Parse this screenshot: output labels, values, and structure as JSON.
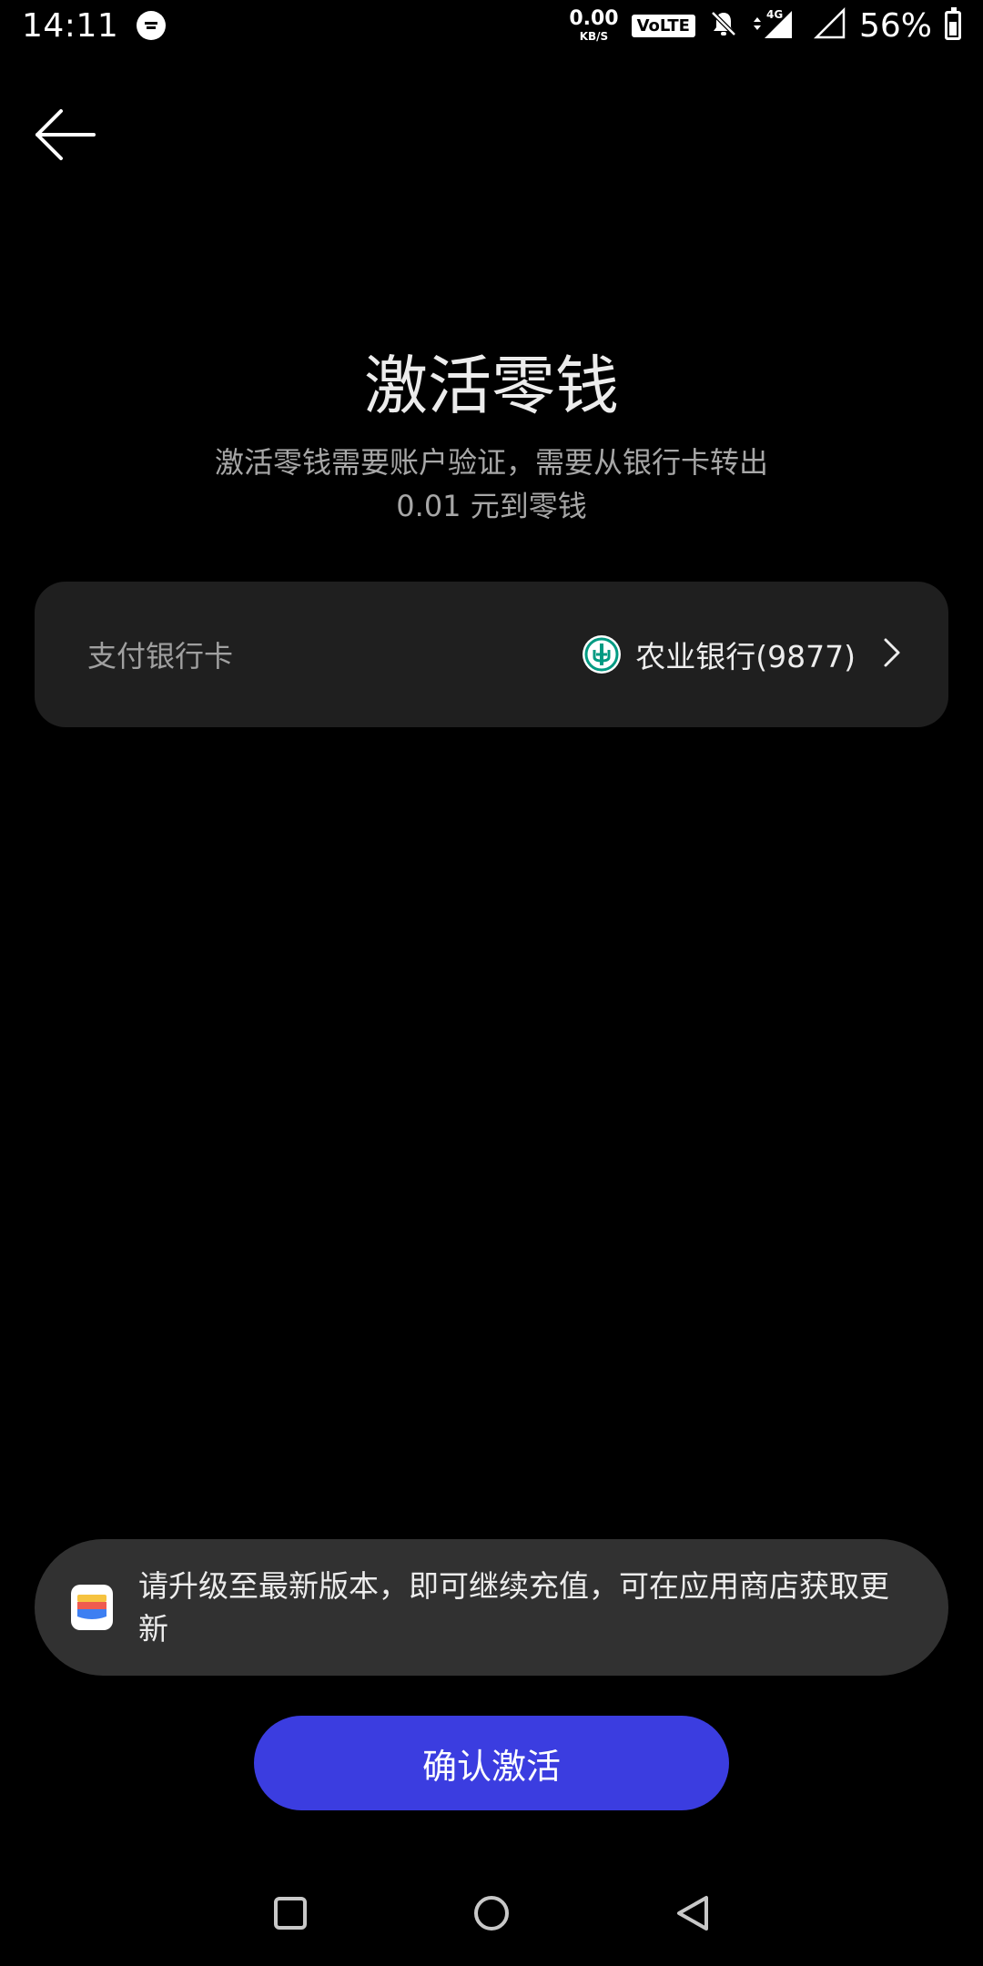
{
  "status_bar": {
    "time": "14:11",
    "net_speed_value": "0.00",
    "net_speed_unit": "KB/S",
    "volte": "VoLTE",
    "network_type": "4G",
    "battery_percent": "56%",
    "battery_level": 0.56
  },
  "header": {
    "back_icon": "arrow-left-icon"
  },
  "main": {
    "title": "激活零钱",
    "subtitle_line1": "激活零钱需要账户验证，需要从银行卡转出",
    "subtitle_line2": "0.01 元到零钱"
  },
  "card": {
    "label": "支付银行卡",
    "bank_name": "农业银行(9877)",
    "bank_logo_icon": "abc-bank-logo-icon",
    "chevron_icon": "chevron-right-icon",
    "bank_brand_color": "#009a82"
  },
  "toast": {
    "app_icon": "wallet-app-icon",
    "message": "请升级至最新版本，即可继续充值，可在应用商店获取更新"
  },
  "actions": {
    "confirm_label": "确认激活",
    "confirm_color": "#3b3de0"
  },
  "nav_bar": {
    "recents_icon": "square-icon",
    "home_icon": "circle-icon",
    "back_icon": "triangle-back-icon"
  }
}
